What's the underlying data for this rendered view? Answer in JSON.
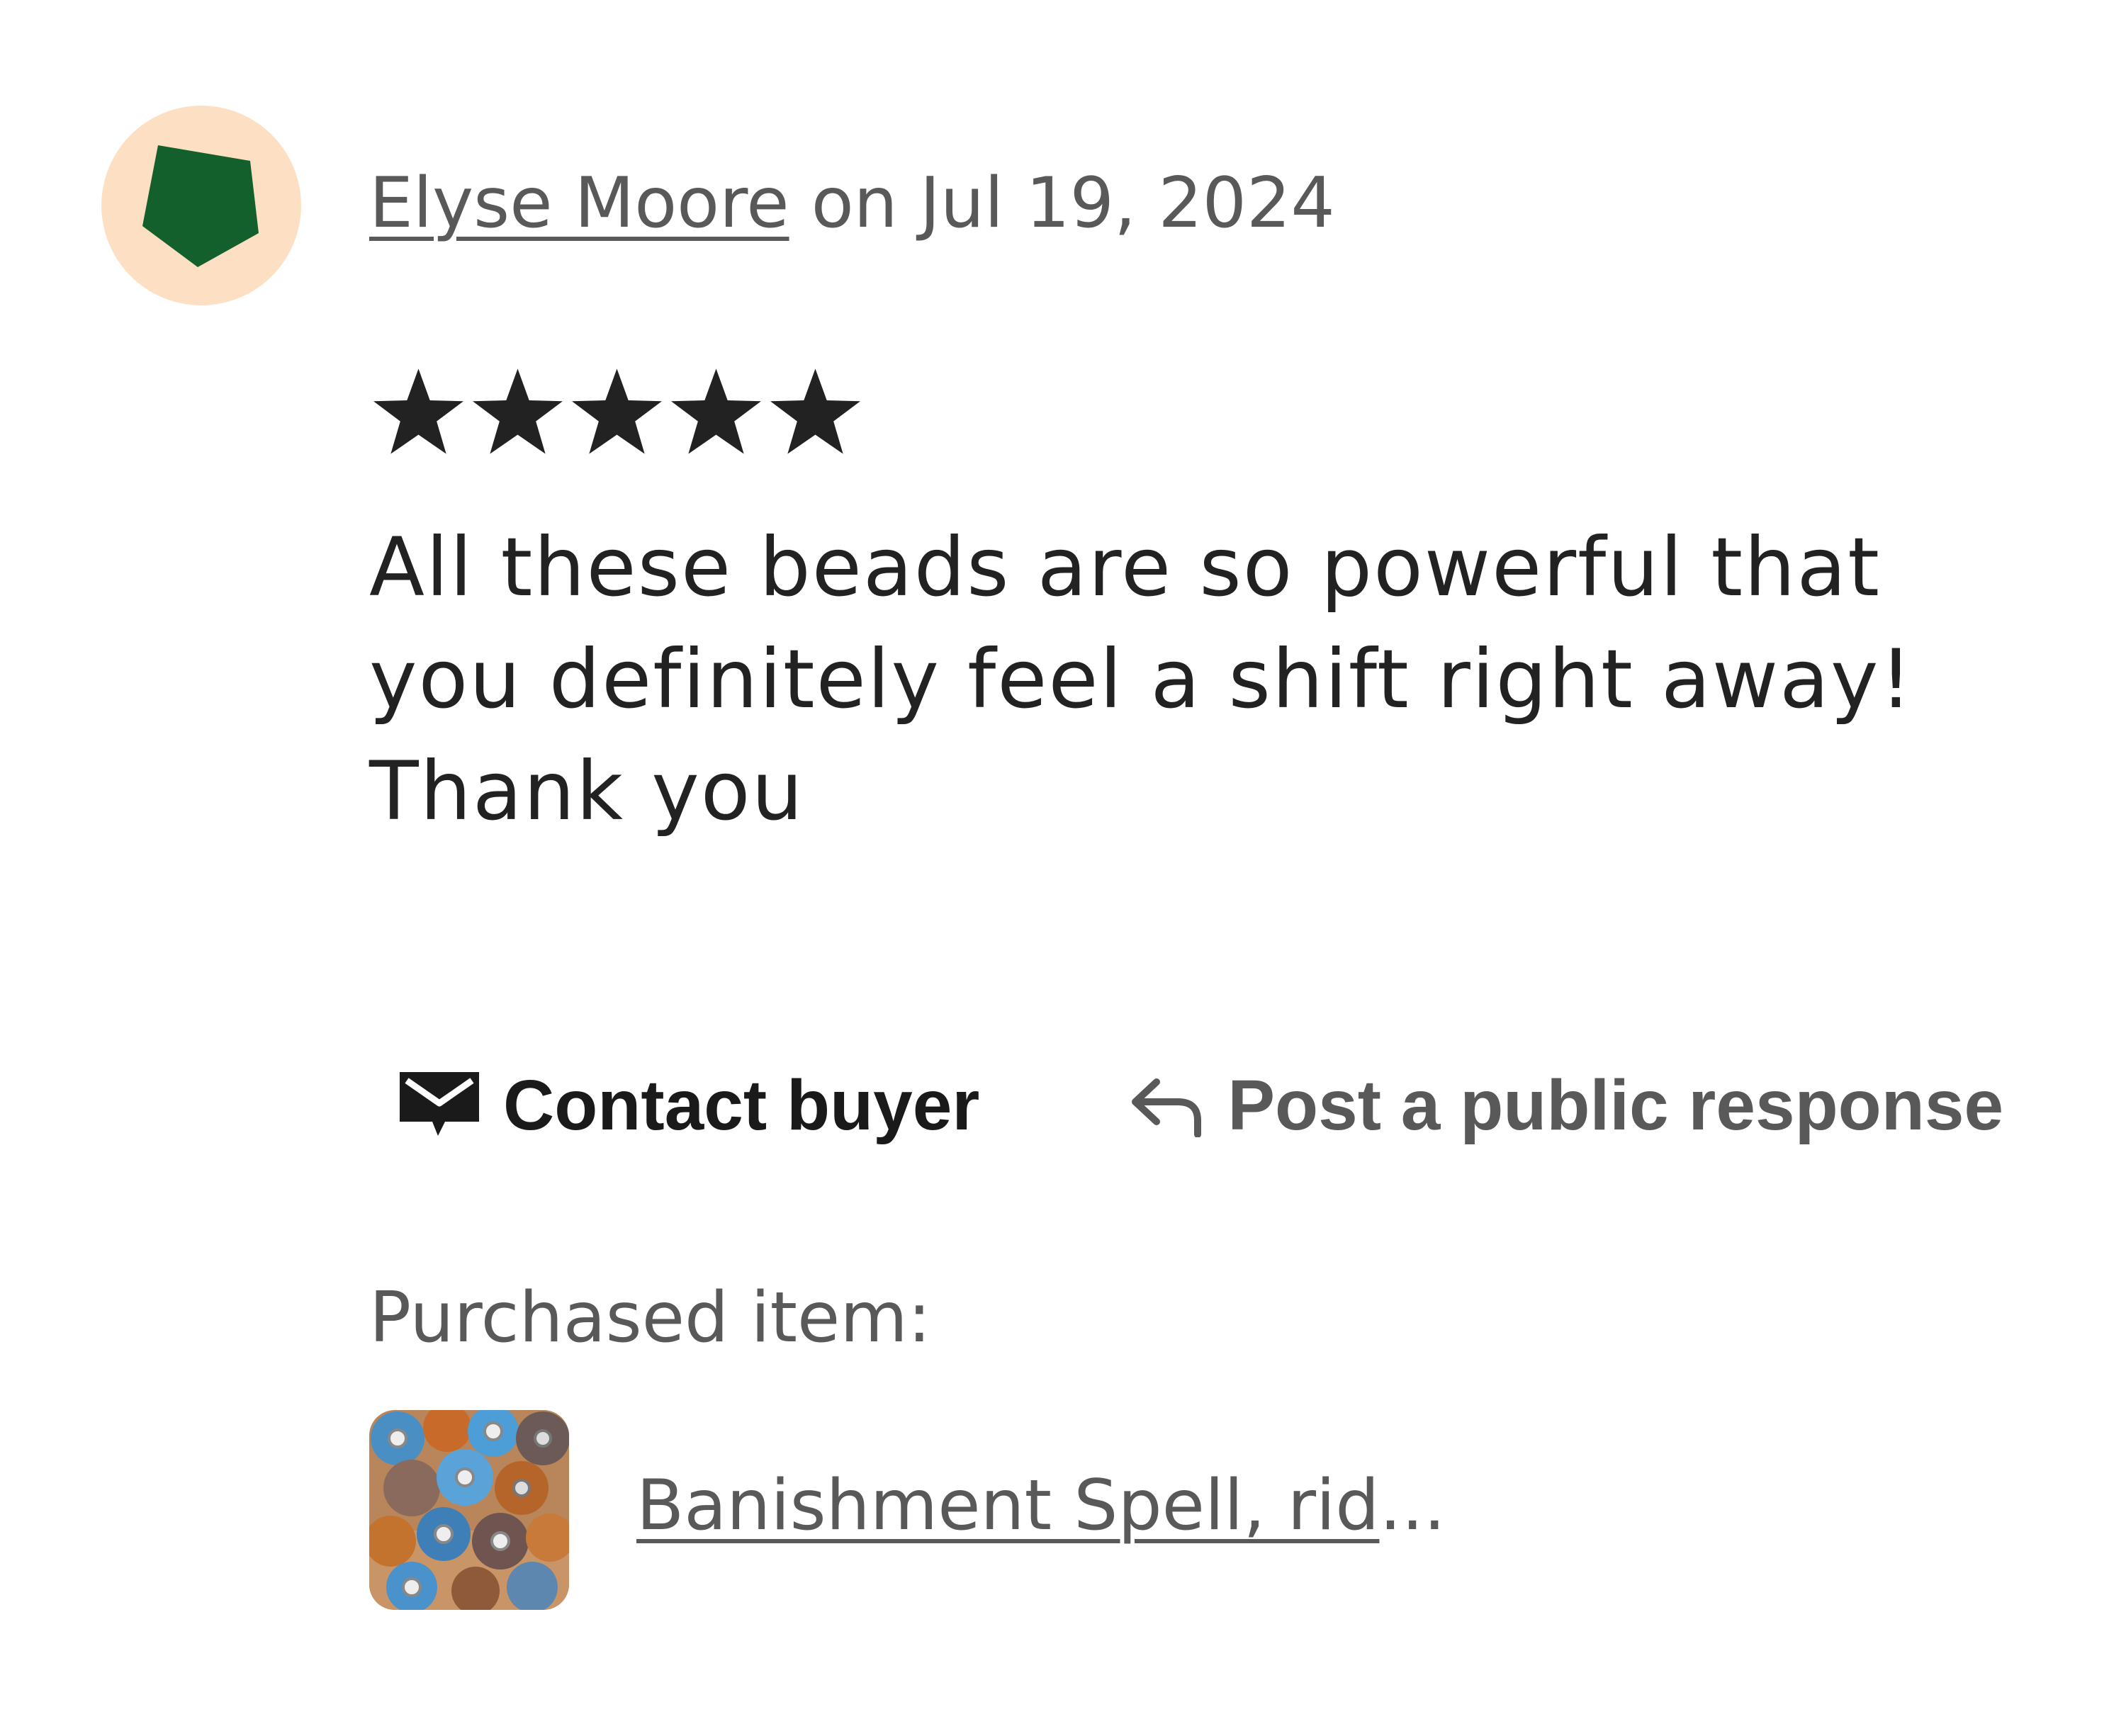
{
  "review": {
    "reviewer_name": "Elyse Moore",
    "date_text": "on Jul 19, 2024",
    "rating": 5,
    "max_rating": 5,
    "text": "All these beads are so powerful that you definitely feel a shift right away! Thank you"
  },
  "actions": {
    "contact_label": "Contact buyer",
    "respond_label": "Post a public response"
  },
  "purchase": {
    "label": "Purchased item:",
    "item_title": "Banishment Spell, rid",
    "ellipsis": "..."
  },
  "colors": {
    "avatar_background": "#fde0c3",
    "avatar_shape": "#14602c",
    "star": "#222222",
    "muted_text": "#595959",
    "body_text": "#222222"
  },
  "icons": {
    "contact": "envelope-icon",
    "respond": "reply-arrow-icon",
    "rating": "star-icon"
  }
}
